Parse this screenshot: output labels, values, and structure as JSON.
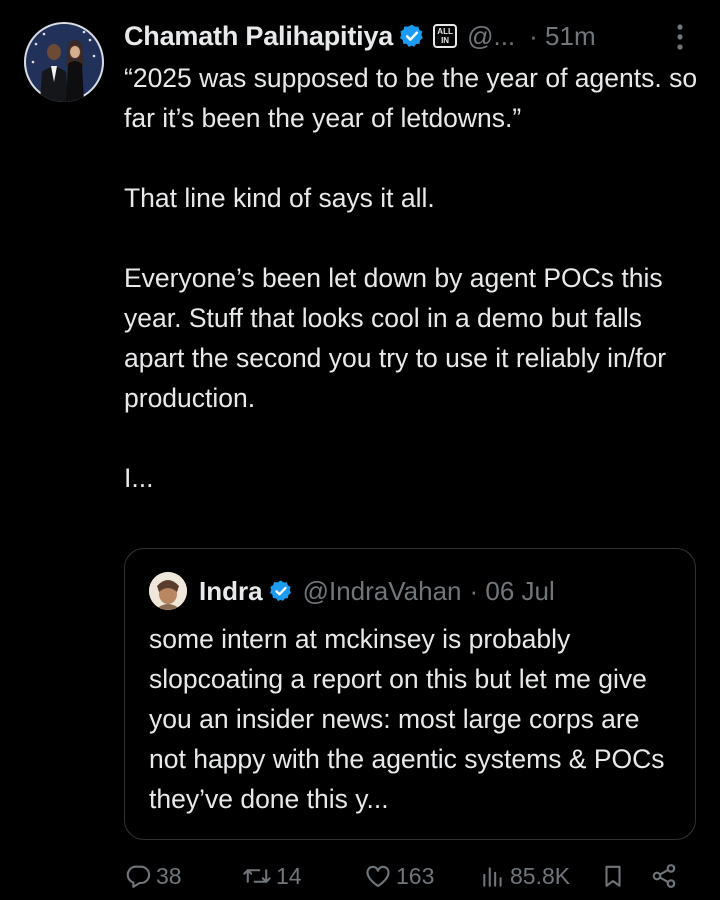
{
  "tweet": {
    "author_name": "Chamath Palihapitiya",
    "affiliation_badge_text": [
      "ALL",
      "IN"
    ],
    "handle": "@...",
    "time": "· 51m",
    "paragraphs": [
      "“2025 was supposed to be the year of agents. so far it’s been the year of letdowns.”",
      "That line kind of says it all.",
      "Everyone’s been let down by agent POCs this year. Stuff that looks cool in a demo but falls apart the second you try to use it reliably in/for production.",
      "I..."
    ]
  },
  "quoted": {
    "name": "Indra",
    "handle": "@IndraVahan",
    "date": "· 06 Jul",
    "text": "some intern at mckinsey is probably slopcoating a report on this but let me give you an insider news: most large corps are not happy with the agentic systems & POCs they’ve done this y..."
  },
  "actions": {
    "replies": "38",
    "reposts": "14",
    "likes": "163",
    "views": "85.8K"
  },
  "colors": {
    "background": "#000000",
    "text": "#e7e9ea",
    "muted": "#71767b",
    "verified": "#1d9bf0",
    "border": "#2f3336"
  },
  "icons": [
    "verified-icon",
    "more-icon",
    "reply-icon",
    "repost-icon",
    "like-icon",
    "views-icon",
    "bookmark-icon",
    "share-icon"
  ]
}
